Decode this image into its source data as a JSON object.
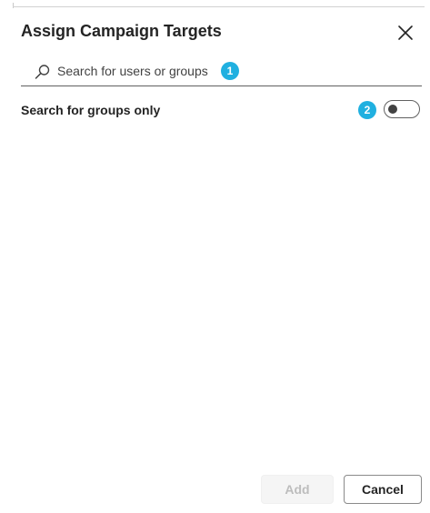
{
  "dialog": {
    "title": "Assign Campaign Targets",
    "close_icon": "close-icon"
  },
  "search": {
    "placeholder": "Search for users or groups",
    "value": "",
    "icon": "search-icon"
  },
  "annotations": {
    "badge_1": "1",
    "badge_2": "2",
    "badge_color": "#20b0e0"
  },
  "groups_only": {
    "label": "Search for groups only",
    "enabled": false
  },
  "footer": {
    "add_label": "Add",
    "cancel_label": "Cancel"
  }
}
